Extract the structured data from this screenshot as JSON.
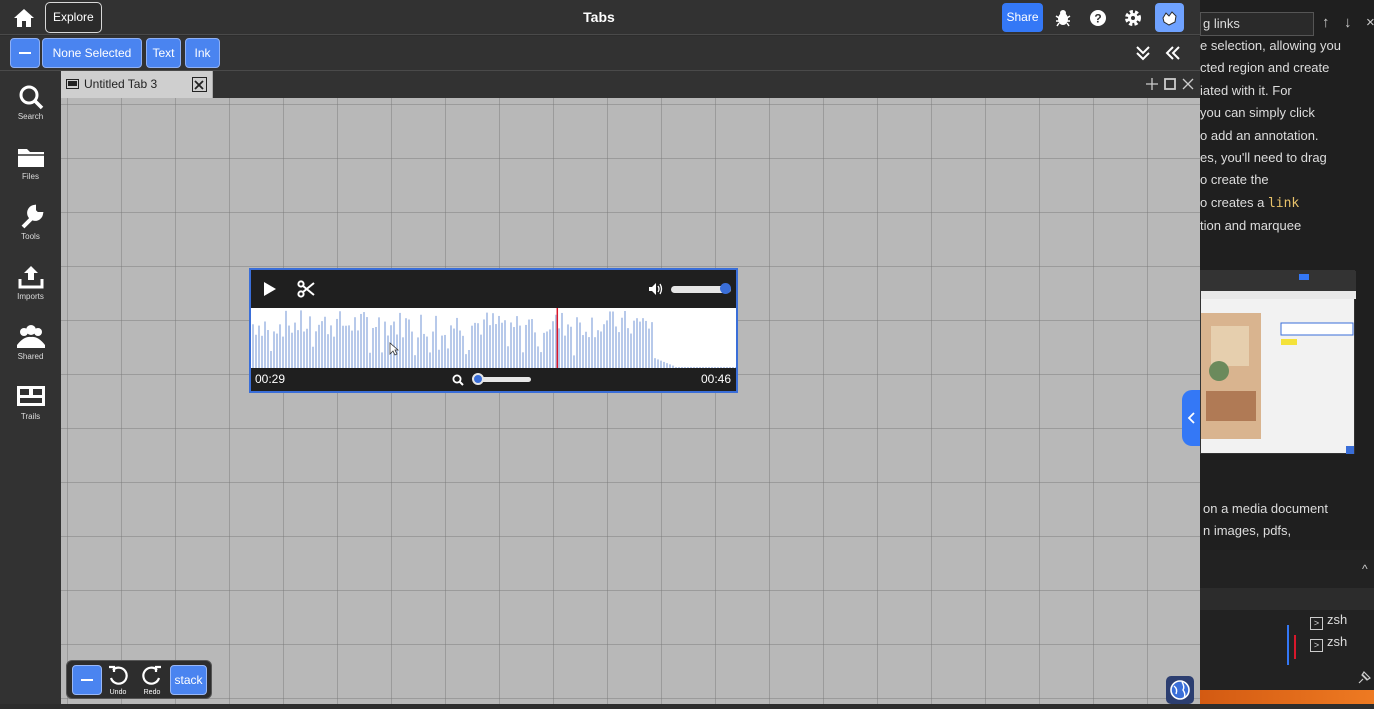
{
  "topbar": {
    "explore_label": "Explore",
    "title": "Tabs",
    "share_label": "Share",
    "icons": [
      "home-icon",
      "bug-icon",
      "help-icon",
      "gear-icon",
      "hand-icon"
    ]
  },
  "toolbar": {
    "selection_label": "None Selected",
    "text_label": "Text",
    "ink_label": "Ink"
  },
  "sidebar": {
    "items": [
      {
        "label": "Search",
        "icon": "search-icon"
      },
      {
        "label": "Files",
        "icon": "folder-icon"
      },
      {
        "label": "Tools",
        "icon": "wrench-icon"
      },
      {
        "label": "Imports",
        "icon": "upload-icon"
      },
      {
        "label": "Shared",
        "icon": "people-icon"
      },
      {
        "label": "Trails",
        "icon": "trails-icon"
      }
    ]
  },
  "tab": {
    "label": "Untitled Tab 3"
  },
  "audio": {
    "current_time": "00:29",
    "duration": "00:46",
    "progress_fraction": 0.63,
    "volume_fraction": 1.0,
    "zoom_fraction": 0.0
  },
  "bottom_tools": {
    "undo_label": "Undo",
    "redo_label": "Redo",
    "stack_label": "stack"
  },
  "right_panel": {
    "search_value": "g links",
    "lines": [
      "e selection, allowing you",
      "cted region and create",
      "iated with it. For",
      " you can simply click",
      "o add an annotation.",
      "es, you'll need to drag",
      "o create the",
      "o creates a ",
      "tion and marquee"
    ],
    "code_word": "link",
    "lines2": [
      "on a media document",
      "n images, pdfs,"
    ],
    "terminals": [
      "zsh",
      "zsh"
    ]
  },
  "colors": {
    "accent": "#3478f6",
    "canvas": "#b8b8b8",
    "waveform": "#b7c9ea",
    "playhead": "#d9182b"
  }
}
